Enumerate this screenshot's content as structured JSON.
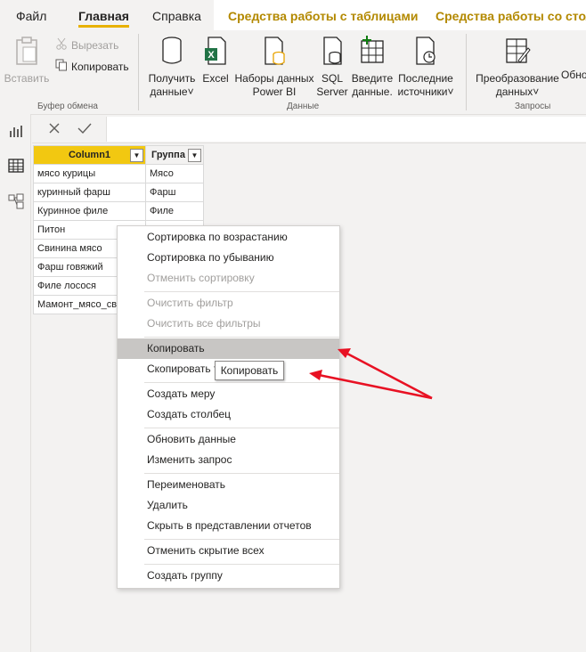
{
  "tabs": {
    "file": "Файл",
    "home": "Главная",
    "help": "Справка",
    "table_tools": "Средства работы с таблицами",
    "column_tools": "Средства работы со столб"
  },
  "ribbon": {
    "clipboard": {
      "paste": "Вставить",
      "cut": "Вырезать",
      "copy": "Копировать",
      "group_label": "Буфер обмена"
    },
    "data": {
      "get_data_line1": "Получить",
      "get_data_line2": "данные",
      "excel": "Excel",
      "datasets_line1": "Наборы данных",
      "datasets_line2": "Power BI",
      "sql_line1": "SQL",
      "sql_line2": "Server",
      "enter_line1": "Введите",
      "enter_line2": "данные.",
      "recent_line1": "Последние",
      "recent_line2": "источники",
      "group_label": "Данные"
    },
    "queries": {
      "transform_line1": "Преобразование",
      "transform_line2": "данных",
      "refresh_partial": "Обно",
      "group_label": "Запросы"
    }
  },
  "table": {
    "columns": [
      "Column1",
      "Группа"
    ],
    "rows": [
      [
        "мясо курицы",
        "Мясо"
      ],
      [
        "куринный фарш",
        "Фарш"
      ],
      [
        "Куринное филе",
        "Филе"
      ],
      [
        "Питон",
        ""
      ],
      [
        "Свинина мясо",
        ""
      ],
      [
        "Фарш говяжий",
        ""
      ],
      [
        "Филе лосося",
        ""
      ],
      [
        "Мамонт_мясо_св",
        ""
      ]
    ]
  },
  "context_menu": {
    "items": [
      {
        "label": "Сортировка по возрастанию",
        "enabled": true
      },
      {
        "label": "Сортировка по убыванию",
        "enabled": true
      },
      {
        "label": "Отменить сортировку",
        "enabled": false
      },
      {
        "label": "Очистить фильтр",
        "enabled": false
      },
      {
        "label": "Очистить все фильтры",
        "enabled": false
      },
      {
        "label": "Копировать",
        "enabled": true,
        "highlighted": true
      },
      {
        "label": "Скопировать т",
        "enabled": true
      },
      {
        "label": "Создать меру",
        "enabled": true
      },
      {
        "label": "Создать столбец",
        "enabled": true
      },
      {
        "label": "Обновить данные",
        "enabled": true
      },
      {
        "label": "Изменить запрос",
        "enabled": true
      },
      {
        "label": "Переименовать",
        "enabled": true
      },
      {
        "label": "Удалить",
        "enabled": true
      },
      {
        "label": "Скрыть в представлении отчетов",
        "enabled": true
      },
      {
        "label": "Отменить скрытие всех",
        "enabled": true
      },
      {
        "label": "Создать группу",
        "enabled": true
      }
    ]
  },
  "tooltip": "Копировать",
  "colors": {
    "accent": "#f2c811",
    "annotation_arrow": "#e81123",
    "context_tab_text": "#b38900"
  }
}
